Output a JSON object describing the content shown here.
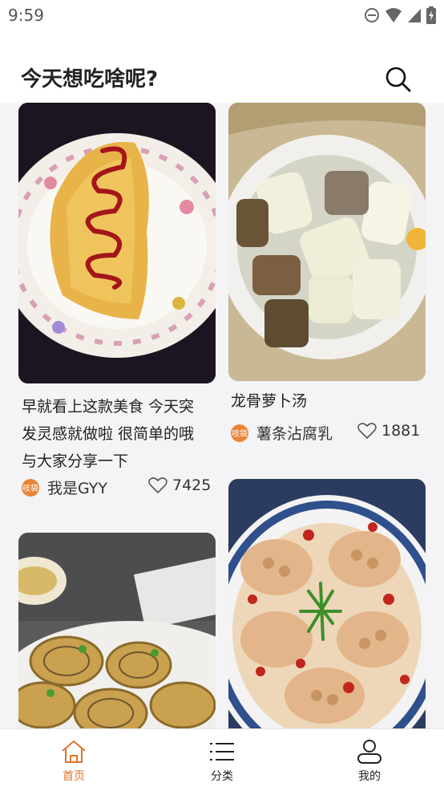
{
  "status_bar": {
    "time": "9:59"
  },
  "header": {
    "title": "今天想吃啥呢?",
    "search_icon": "search-icon"
  },
  "feed": {
    "cards": [
      {
        "title_lines": [
          "早就看上这款美食 今天突",
          "发灵感就做啦 很简单的哦",
          "与大家分享一下"
        ],
        "author": "我是GYY",
        "likes": "7425",
        "avatar_text": "吱袋"
      },
      {
        "title_lines": [
          "龙骨萝卜汤"
        ],
        "author": "薯条沾腐乳",
        "likes": "1881",
        "avatar_text": "吱袋"
      }
    ]
  },
  "tabbar": {
    "items": [
      {
        "label": "首页",
        "icon": "home-icon",
        "active": true
      },
      {
        "label": "分类",
        "icon": "list-icon",
        "active": false
      },
      {
        "label": "我的",
        "icon": "user-icon",
        "active": false
      }
    ]
  },
  "colors": {
    "accent": "#e2732e",
    "background": "#f4f4f6"
  }
}
